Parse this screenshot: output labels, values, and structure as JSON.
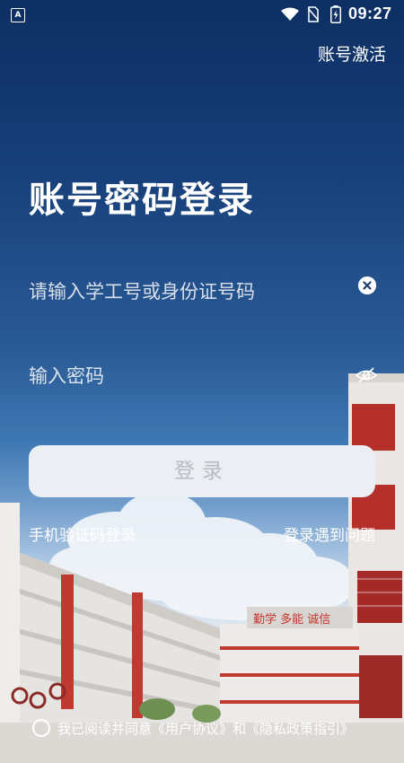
{
  "status_bar": {
    "time": "09:27",
    "app_indicator": "A",
    "icons": [
      "wifi-icon",
      "no-sim-icon",
      "battery-charging-icon"
    ]
  },
  "header": {
    "activate_label": "账号激活"
  },
  "login": {
    "title": "账号密码登录",
    "account_placeholder": "请输入学工号或身份证号码",
    "password_placeholder": "输入密码",
    "submit_label": "登录"
  },
  "links": {
    "sms_login": "手机验证码登录",
    "help": "登录遇到问题"
  },
  "background": {
    "banner_text": "勤学 多能 诚信"
  },
  "agreement": {
    "prefix": "我已阅读并同意",
    "user_agreement": "《用户协议》",
    "conjunction": "和",
    "privacy_policy": "《隐私政策指引》",
    "checked": false
  }
}
